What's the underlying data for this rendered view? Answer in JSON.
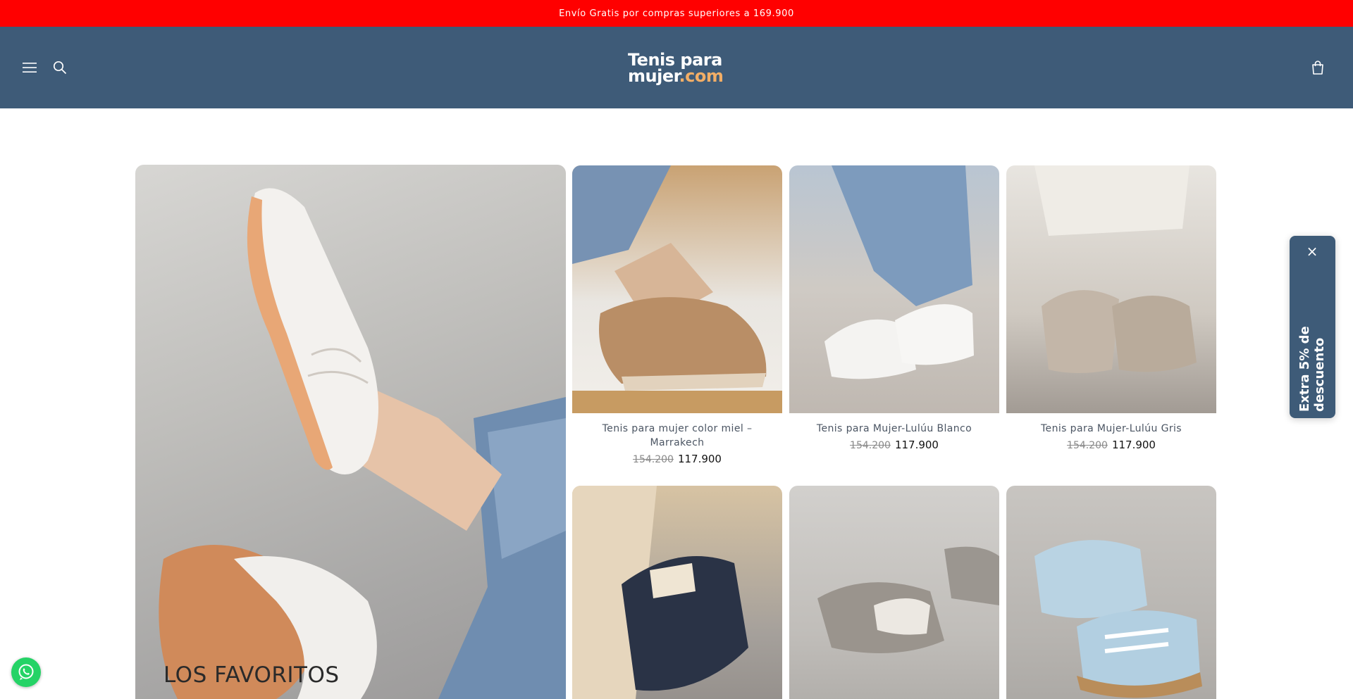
{
  "announcement": {
    "text": "Envío Gratis por compras superiores a 169.900"
  },
  "header": {
    "logo_line1": "Tenis para",
    "logo_line2_main": "mujer",
    "logo_line2_accent": ".com",
    "icons": {
      "menu": "hamburger-icon",
      "search": "search-icon",
      "cart": "cart-icon"
    }
  },
  "hero": {
    "title": "LOS FAVORITOS"
  },
  "products": [
    {
      "title": "Tenis para mujer color miel – Marrakech",
      "old_price": "154.200",
      "price": "117.900"
    },
    {
      "title": "Tenis para Mujer-Lulúu Blanco",
      "old_price": "154.200",
      "price": "117.900"
    },
    {
      "title": "Tenis para Mujer-Lulúu Gris",
      "old_price": "154.200",
      "price": "117.900"
    },
    {
      "title": "",
      "old_price": "",
      "price": ""
    },
    {
      "title": "",
      "old_price": "",
      "price": ""
    },
    {
      "title": "",
      "old_price": "",
      "price": ""
    }
  ],
  "discount_tab": {
    "text": "Extra 5% de descuento",
    "close": "×"
  },
  "colors": {
    "announcement": "#ff0000",
    "header": "#3e5b78",
    "logo_accent": "#f2ae66",
    "whatsapp": "#25d366"
  }
}
